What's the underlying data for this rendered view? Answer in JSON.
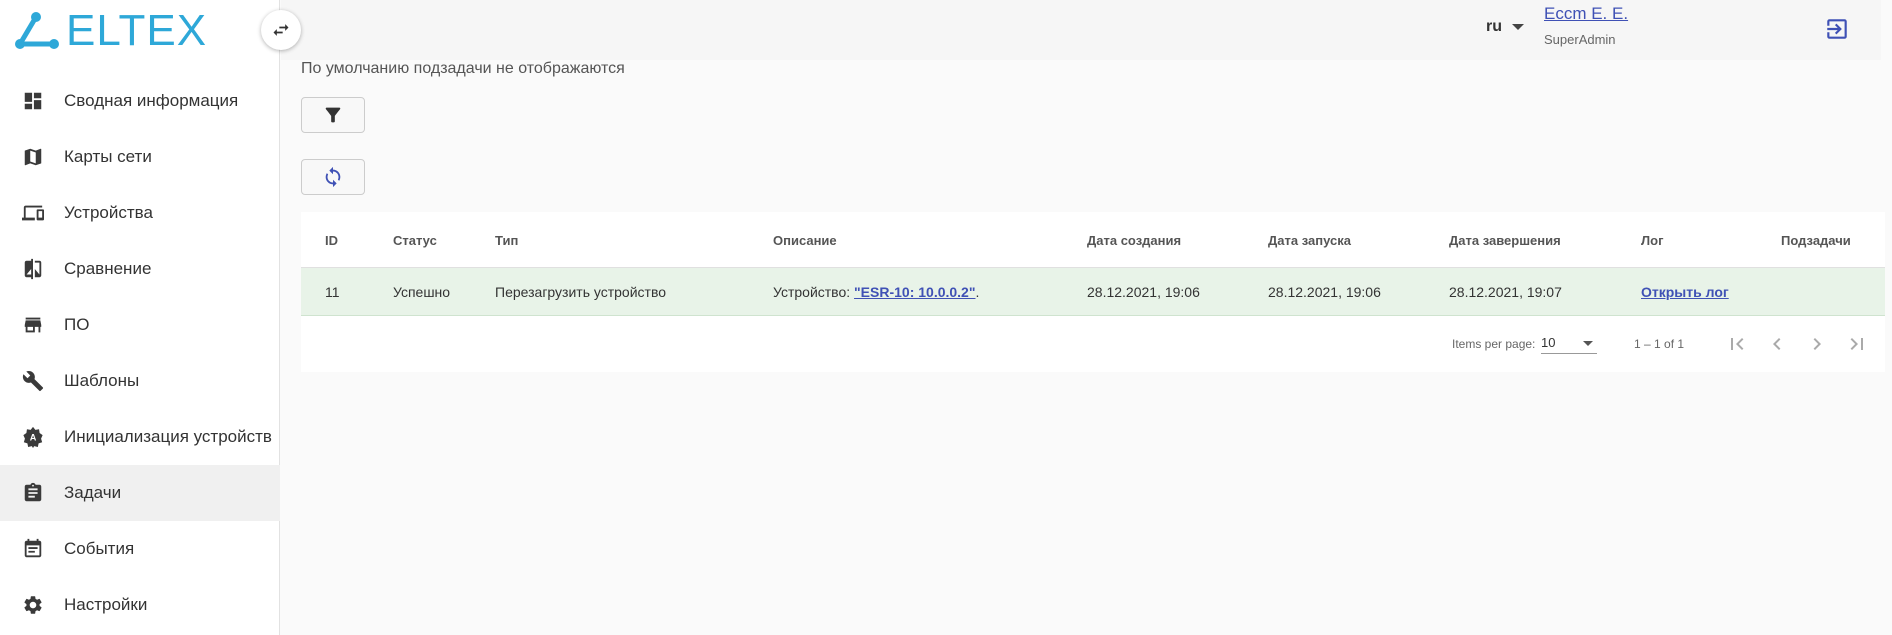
{
  "app": {
    "logo_text": "ELTEX"
  },
  "sidebar": {
    "items": [
      {
        "label": "Сводная информация",
        "icon": "dashboard-icon"
      },
      {
        "label": "Карты сети",
        "icon": "map-icon"
      },
      {
        "label": "Устройства",
        "icon": "devices-icon"
      },
      {
        "label": "Сравнение",
        "icon": "compare-icon"
      },
      {
        "label": "ПО",
        "icon": "store-icon"
      },
      {
        "label": "Шаблоны",
        "icon": "wrench-icon"
      },
      {
        "label": "Инициализация устройств",
        "icon": "init-badge-icon"
      },
      {
        "label": "Задачи",
        "icon": "clipboard-icon",
        "active": true
      },
      {
        "label": "События",
        "icon": "calendar-icon"
      },
      {
        "label": "Настройки",
        "icon": "gear-icon"
      }
    ]
  },
  "header": {
    "language": "ru",
    "user_name": "Eccm E. E.",
    "user_role": "SuperAdmin"
  },
  "main": {
    "hint": "По умолчанию подзадачи не отображаются",
    "table": {
      "columns": [
        "ID",
        "Статус",
        "Тип",
        "Описание",
        "Дата создания",
        "Дата запуска",
        "Дата завершения",
        "Лог",
        "Подзадачи"
      ],
      "rows": [
        {
          "id": "11",
          "status": "Успешно",
          "type": "Перезагрузить устройство",
          "description_prefix": "Устройство: ",
          "description_link": "\"ESR-10: 10.0.0.2\"",
          "description_suffix": ".",
          "created": "28.12.2021, 19:06",
          "started": "28.12.2021, 19:06",
          "finished": "28.12.2021, 19:07",
          "log_link": "Открыть лог",
          "subtasks": ""
        }
      ]
    },
    "paginator": {
      "items_per_page_label": "Items per page:",
      "items_per_page": "10",
      "range": "1 – 1 of 1"
    }
  },
  "colors": {
    "accent": "#3f51b5",
    "logo": "#2ea8d8",
    "success_row": "#e8f3e8"
  }
}
